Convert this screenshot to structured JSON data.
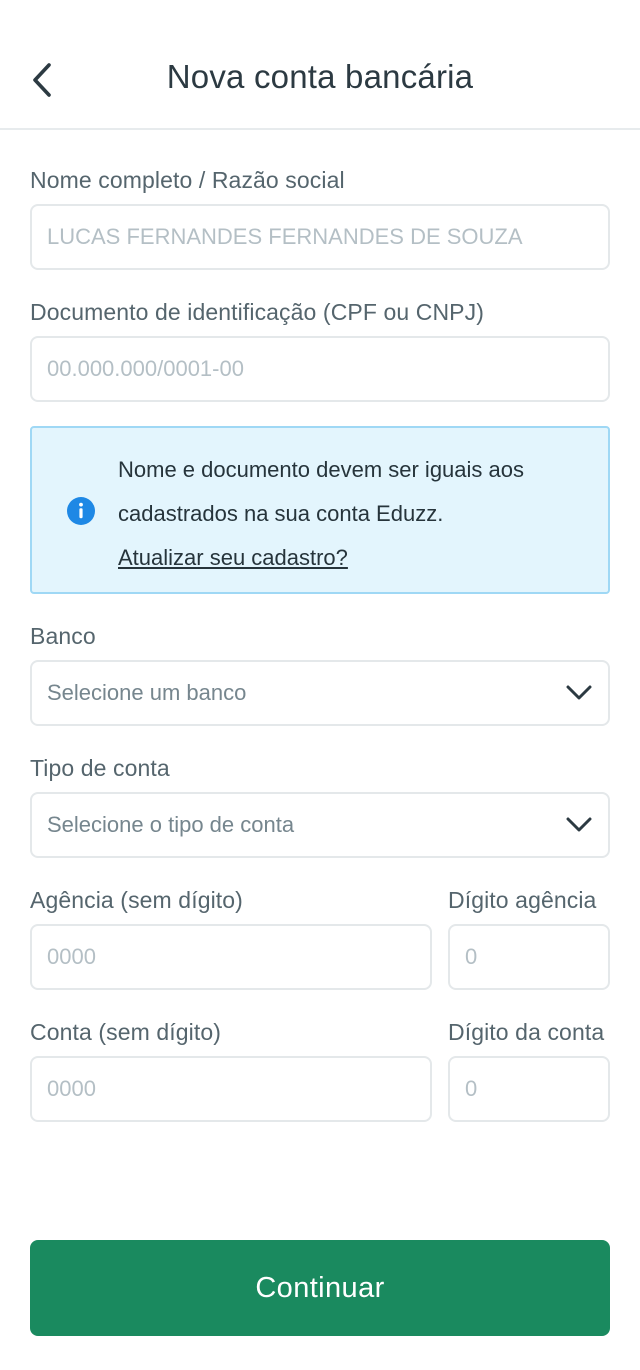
{
  "header": {
    "title": "Nova conta bancária",
    "back_icon": "chevron-left-icon"
  },
  "form": {
    "name": {
      "label": "Nome completo / Razão social",
      "placeholder": "LUCAS FERNANDES FERNANDES DE SOUZA",
      "value": ""
    },
    "document": {
      "label": "Documento de identificação (CPF ou CNPJ)",
      "placeholder": "00.000.000/0001-00",
      "value": ""
    },
    "info": {
      "icon": "info-icon",
      "text": "Nome e documento devem ser iguais aos cadastrados na sua conta Eduzz.",
      "link": "Atualizar seu cadastro?"
    },
    "bank": {
      "label": "Banco",
      "value": "Selecione um banco"
    },
    "account_type": {
      "label": "Tipo de conta",
      "value": "Selecione o tipo de conta"
    },
    "agency": {
      "label": "Agência (sem dígito)",
      "placeholder": "0000"
    },
    "agency_digit": {
      "label": "Dígito agência",
      "placeholder": "0"
    },
    "account": {
      "label": "Conta (sem dígito)",
      "placeholder": "0000"
    },
    "account_digit": {
      "label": "Dígito da conta",
      "placeholder": "0"
    }
  },
  "continue_label": "Continuar",
  "colors": {
    "primary": "#1a8a5f",
    "info_bg": "#e3f5fd",
    "info_border": "#9fd8f5",
    "info_icon": "#1e88e5"
  }
}
